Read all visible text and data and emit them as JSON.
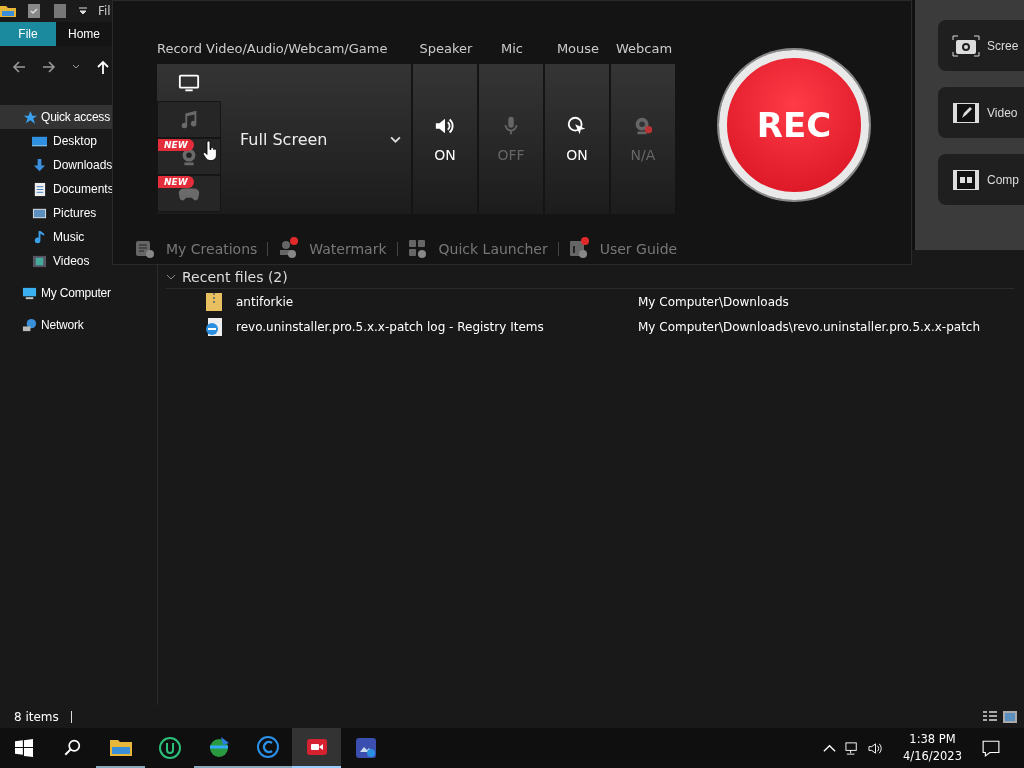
{
  "explorer": {
    "title": "Fil",
    "ribbon_tabs": [
      {
        "label": "File",
        "selected": true
      },
      {
        "label": "Home",
        "selected": false
      }
    ],
    "nav": [
      {
        "label": "Quick access",
        "kind": "star",
        "selected": true,
        "children": [
          {
            "label": "Desktop",
            "kind": "desktop",
            "selected": false
          },
          {
            "label": "Downloads",
            "kind": "download",
            "selected": false
          },
          {
            "label": "Documents",
            "kind": "document",
            "selected": false
          },
          {
            "label": "Pictures",
            "kind": "pictures",
            "selected": false
          },
          {
            "label": "Music",
            "kind": "music",
            "selected": false
          },
          {
            "label": "Videos",
            "kind": "videos",
            "selected": false
          }
        ]
      },
      {
        "label": "My Computer",
        "kind": "computer",
        "selected": false
      },
      {
        "label": "Network",
        "kind": "network",
        "selected": false
      }
    ],
    "recent": {
      "header": "Recent files (2)",
      "expanded": true,
      "files": [
        {
          "name": "antiforkie",
          "location": "My Computer\\Downloads",
          "kind": "zip"
        },
        {
          "name": "revo.uninstaller.pro.5.x.x-patch log - Registry Items",
          "location": "My Computer\\Downloads\\revo.uninstaller.pro.5.x.x-patch",
          "kind": "web"
        }
      ]
    },
    "status": "8 items"
  },
  "recorder": {
    "mode_label": "Record Video/Audio/Webcam/Game",
    "modes": [
      {
        "kind": "screen",
        "selected": true
      },
      {
        "kind": "audio",
        "selected": false
      },
      {
        "kind": "webcam",
        "selected": false,
        "badge": "NEW"
      },
      {
        "kind": "game",
        "selected": false,
        "badge": "NEW"
      }
    ],
    "area": "Full Screen",
    "toggles": [
      {
        "label": "Speaker",
        "kind": "speaker",
        "state": "ON",
        "on": true
      },
      {
        "label": "Mic",
        "kind": "mic",
        "state": "OFF",
        "on": false
      },
      {
        "label": "Mouse",
        "kind": "mouse",
        "state": "ON",
        "on": true
      },
      {
        "label": "Webcam",
        "kind": "webcam",
        "state": "N/A",
        "on": false
      }
    ],
    "rec": "REC",
    "links": [
      {
        "label": "My Creations",
        "kind": "creations",
        "dot": false
      },
      {
        "label": "Watermark",
        "kind": "watermark",
        "dot": true
      },
      {
        "label": "Quick Launcher",
        "kind": "launcher",
        "dot": false
      },
      {
        "label": "User Guide",
        "kind": "guide",
        "dot": true
      }
    ],
    "tools": {
      "items": [
        {
          "label": "Scree",
          "kind": "screenshot"
        },
        {
          "label": "Video",
          "kind": "editor"
        },
        {
          "label": "Comp",
          "kind": "compress"
        }
      ]
    }
  },
  "taskbar": {
    "apps": [
      {
        "kind": "explorer",
        "running": true,
        "active": false
      },
      {
        "kind": "u-app",
        "running": false,
        "active": false
      },
      {
        "kind": "globe",
        "running": true,
        "active": false
      },
      {
        "kind": "c-app",
        "running": true,
        "active": false
      },
      {
        "kind": "recorder",
        "running": true,
        "active": true
      },
      {
        "kind": "photo",
        "running": false,
        "active": false
      }
    ],
    "time": "1:38 PM",
    "date": "4/16/2023"
  }
}
